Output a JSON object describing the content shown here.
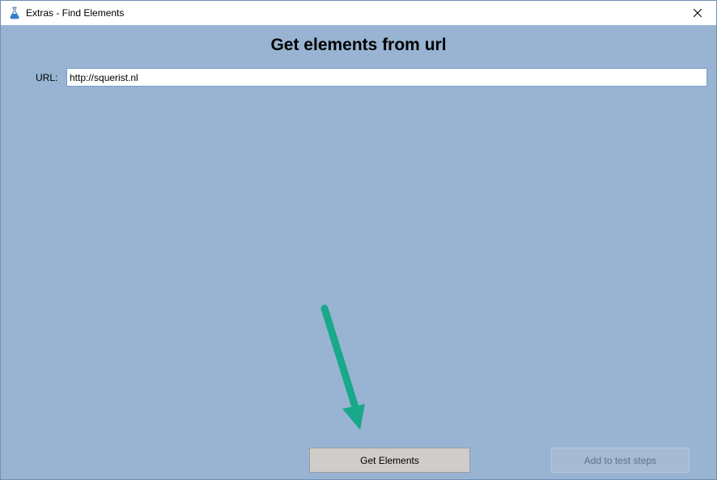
{
  "window": {
    "title": "Extras - Find Elements",
    "icon": "flask-icon",
    "close_icon": "close-icon"
  },
  "form": {
    "heading": "Get elements from url",
    "url_label": "URL:",
    "url_value": "http://squerist.nl"
  },
  "buttons": {
    "get_elements": "Get Elements",
    "add_to_test_steps": "Add to test steps"
  },
  "colors": {
    "background": "#98b4d2",
    "arrow": "#18a88a",
    "button_primary": "#d0ccca",
    "button_disabled_text": "#5e6f85"
  }
}
